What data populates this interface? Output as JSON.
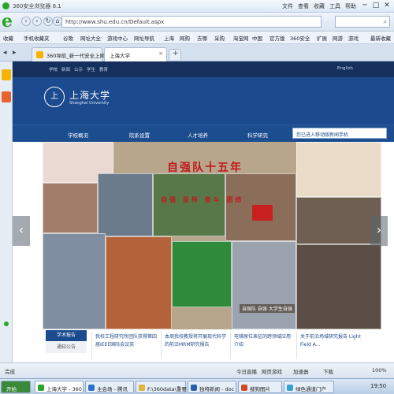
{
  "window": {
    "title": "360安全浏览器 8.1",
    "menu": [
      "文件",
      "查看",
      "收藏",
      "工具",
      "帮助"
    ],
    "controls": [
      "─",
      "□",
      "✕"
    ]
  },
  "address": {
    "url": "http://www.shu.edu.cn/Default.aspx",
    "back": "‹",
    "forward": "›",
    "refresh": "↻",
    "home": "⌂"
  },
  "favorites": [
    "收藏",
    "手机收藏夹",
    "谷歌",
    "网址大全",
    "游戏中心",
    "网址导航",
    "上海",
    "网购",
    "去哪",
    "采购",
    "淘宝网",
    "中国",
    "官方版",
    "360安全",
    "扩展",
    "网游",
    "游戏",
    "影视",
    "直播",
    "最新收藏"
  ],
  "tabs": [
    {
      "label": "360导航_新一代安全上网导航"
    },
    {
      "label": "上海大学"
    }
  ],
  "site": {
    "toplinks": [
      "学校",
      "新闻",
      "公示",
      "学生",
      "教育"
    ],
    "lang": "English",
    "logo_text": "上",
    "name": "上海大学",
    "name_en": "Shanghai University",
    "nav": [
      "学校概况",
      "院系设置",
      "人才培养",
      "科学研究"
    ],
    "mobile": "您已进入移动版新闻手机"
  },
  "banner": {
    "headline": "自强队十五年",
    "slogan": "自强 坚持 奋斗 团结",
    "caption": "自强队 自强 大学生自强"
  },
  "news": {
    "tab_active": "学术报告",
    "tab_other": "通知公告",
    "items": [
      "我校工程研究所团队获得第四届IEEE国际会议奖",
      "本周我校教授将开展现代科学的前沿MRM研究报告",
      "电镜原位表征的跨领域应用介绍",
      "关于前沿场域研究报告 Light Field A..."
    ]
  },
  "statusbar": {
    "left": "完成",
    "mid": [
      "今日直播",
      "网页游戏",
      "加速器",
      "下载"
    ],
    "zoom": "100%"
  },
  "taskbar": {
    "start": "开始",
    "items": [
      "上海大学 - 360",
      "主会场 - 腾讯",
      "F:\\360data\\重要",
      "独特新闻 - doc",
      "搜狗图片",
      "绿色通道门户"
    ],
    "time": "19:50"
  }
}
